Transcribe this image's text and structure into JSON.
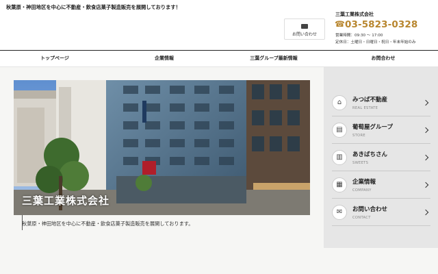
{
  "header": {
    "tagline": "秋葉原・神田地区を中心に不動産・飲食店菓子製造販売を展開しております！",
    "contact_button": {
      "label": "お問い合わせ",
      "icon": "mail-icon"
    },
    "company_name": "三葉工業株式会社",
    "phone": "03-5823-0328",
    "hours": "営業時間：09:30 〜 17:00",
    "holidays": "定休日：土曜日・日曜日・祝日・年末年始のみ",
    "accent_color": "#b8862e"
  },
  "nav": {
    "items": [
      {
        "label": "トップページ"
      },
      {
        "label": "企業情報"
      },
      {
        "label": "三葉グループ最新情報"
      },
      {
        "label": "お問合わせ"
      }
    ]
  },
  "hero": {
    "title": "三葉工業株式会社",
    "caption": "秋葉原・神田地区を中心に不動産・飲食店菓子製造販売を展開しております。"
  },
  "side_menu": {
    "items": [
      {
        "label": "みつば不動産",
        "sub": "REAL ESTATE",
        "icon": "house-icon"
      },
      {
        "label": "葡萄屋グループ",
        "sub": "STORE",
        "icon": "store-icon"
      },
      {
        "label": "あきばちさん",
        "sub": "SWEETS",
        "icon": "sweets-icon"
      },
      {
        "label": "企業情報",
        "sub": "COMPANY",
        "icon": "company-icon"
      },
      {
        "label": "お問い合わせ",
        "sub": "CONTACT",
        "icon": "mail-icon"
      }
    ]
  }
}
